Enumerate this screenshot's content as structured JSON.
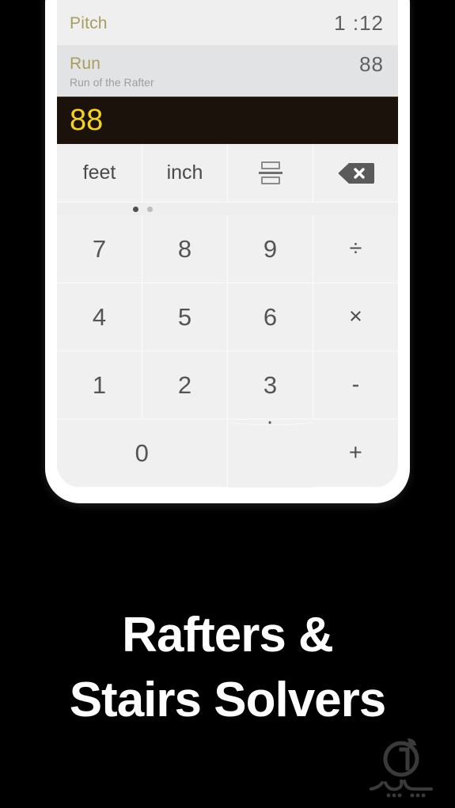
{
  "app": {
    "caption_line1": "Rafters &",
    "caption_line2": "Stairs Solvers",
    "background_color": "#000000",
    "accent_color": "#a79e5e",
    "display_color": "#f5d417",
    "display_background": "#1a120b"
  },
  "results": [
    {
      "label": "Pitch",
      "value": "1 :12",
      "sub": ""
    },
    {
      "label": "Run",
      "value": "88",
      "sub": "Run of the Rafter"
    }
  ],
  "display": {
    "value": "88"
  },
  "function_row": {
    "keys": [
      {
        "label": "feet",
        "icon": ""
      },
      {
        "label": "inch",
        "icon": ""
      },
      {
        "label": "",
        "icon": "fraction-icon"
      },
      {
        "label": "",
        "icon": "backspace-icon"
      }
    ]
  },
  "pagination": {
    "total": 2,
    "active_index": 0
  },
  "keypad": {
    "rows": [
      [
        {
          "label": "7",
          "type": "digit"
        },
        {
          "label": "8",
          "type": "digit"
        },
        {
          "label": "9",
          "type": "digit"
        },
        {
          "label": "÷",
          "type": "operator"
        }
      ],
      [
        {
          "label": "4",
          "type": "digit"
        },
        {
          "label": "5",
          "type": "digit"
        },
        {
          "label": "6",
          "type": "digit"
        },
        {
          "label": "×",
          "type": "operator"
        }
      ],
      [
        {
          "label": "1",
          "type": "digit"
        },
        {
          "label": "2",
          "type": "digit"
        },
        {
          "label": "3",
          "type": "digit"
        },
        {
          "label": "-",
          "type": "operator"
        }
      ],
      [
        {
          "label": "0",
          "type": "digit",
          "wide": true
        },
        {
          "label": "·",
          "type": "decimal"
        },
        {
          "label": "+",
          "type": "operator"
        }
      ]
    ]
  },
  "watermark": {
    "name": "sibapp-logo",
    "script_text": "سیب اپ"
  }
}
